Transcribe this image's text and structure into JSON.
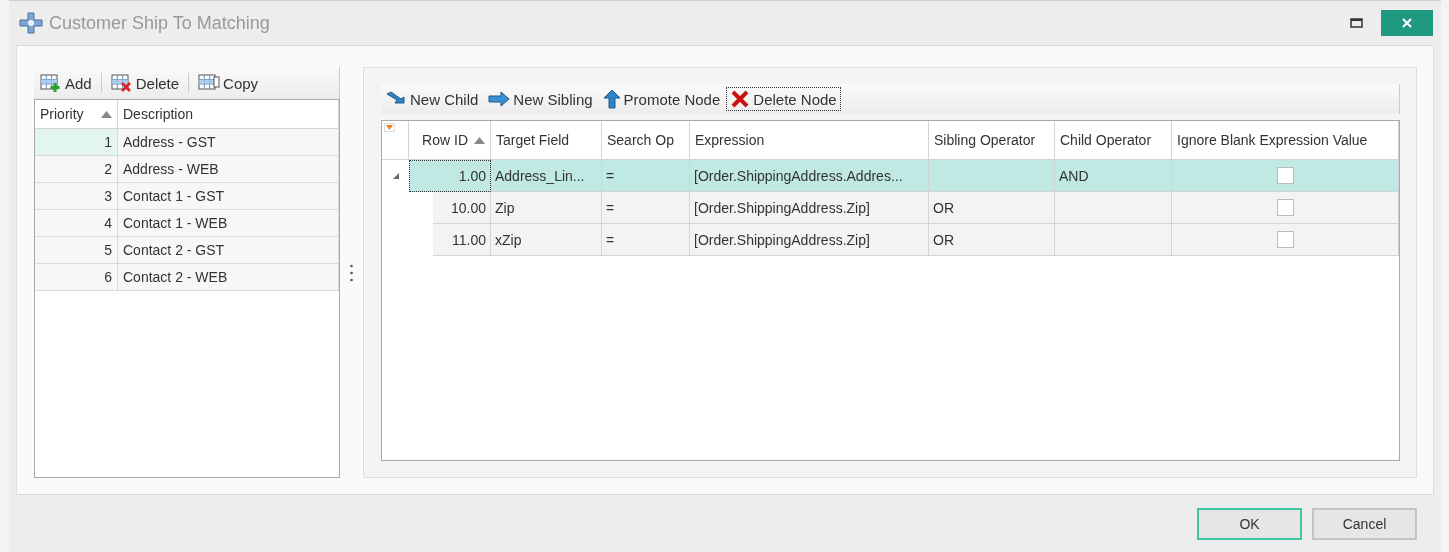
{
  "window": {
    "title": "Customer Ship To Matching"
  },
  "left_toolbar": [
    {
      "label": "Add",
      "kind": "add"
    },
    {
      "label": "Delete",
      "kind": "delete"
    },
    {
      "label": "Copy",
      "kind": "copy"
    }
  ],
  "priority_table": {
    "columns": [
      {
        "label": "Priority",
        "sorted": true
      },
      {
        "label": "Description",
        "sorted": false
      }
    ],
    "rows": [
      {
        "priority": "1",
        "description": "Address - GST",
        "selected": true
      },
      {
        "priority": "2",
        "description": "Address - WEB",
        "selected": false
      },
      {
        "priority": "3",
        "description": "Contact 1 - GST",
        "selected": false
      },
      {
        "priority": "4",
        "description": "Contact 1 - WEB",
        "selected": false
      },
      {
        "priority": "5",
        "description": "Contact 2 - GST",
        "selected": false
      },
      {
        "priority": "6",
        "description": "Contact 2 - WEB",
        "selected": false
      }
    ]
  },
  "tree_toolbar": [
    {
      "label": "New Child",
      "kind": "new-child",
      "focused": false
    },
    {
      "label": "New Sibling",
      "kind": "new-sibling",
      "focused": false
    },
    {
      "label": "Promote Node",
      "kind": "promote",
      "focused": false
    },
    {
      "label": "Delete Node",
      "kind": "delete-node",
      "focused": true
    }
  ],
  "tree_table": {
    "columns": [
      {
        "label": "Row ID",
        "sorted": true
      },
      {
        "label": "Target Field",
        "sorted": false
      },
      {
        "label": "Search Op",
        "sorted": false
      },
      {
        "label": "Expression",
        "sorted": false
      },
      {
        "label": "Sibling Operator",
        "sorted": false
      },
      {
        "label": "Child Operator",
        "sorted": false
      },
      {
        "label": "Ignore Blank Expression Value",
        "sorted": false
      }
    ],
    "rows": [
      {
        "row_id": "1.00",
        "target_field": "Address_Lin...",
        "search_op": "=",
        "expression": "[Order.ShippingAddress.Addres...",
        "child_operator": "AND",
        "ignore_blank": false,
        "selected": true,
        "expanded": true,
        "children": [
          {
            "row_id": "10.00",
            "target_field": "Zip",
            "search_op": "=",
            "expression": "[Order.ShippingAddress.Zip]",
            "sibling_operator": "OR",
            "ignore_blank": false,
            "selected": false
          },
          {
            "row_id": "11.00",
            "target_field": "xZip",
            "search_op": "=",
            "expression": "[Order.ShippingAddress.Zip]",
            "sibling_operator": "OR",
            "ignore_blank": false,
            "selected": false
          }
        ]
      }
    ]
  },
  "buttons": [
    {
      "label": "OK",
      "default": true
    },
    {
      "label": "Cancel",
      "default": false
    }
  ]
}
